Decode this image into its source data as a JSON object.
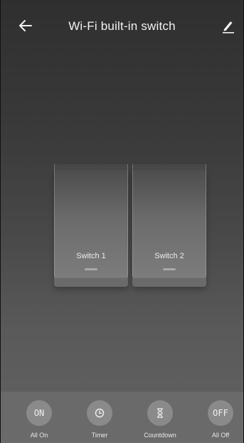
{
  "header": {
    "title": "Wi-Fi built-in switch",
    "back_icon": "arrow-left-icon",
    "edit_icon": "pencil-icon"
  },
  "switches": [
    {
      "label": "Switch 1"
    },
    {
      "label": "Switch 2"
    }
  ],
  "actions": [
    {
      "glyph": "ON",
      "label": "All On",
      "icon": "on-text-icon"
    },
    {
      "glyph": "",
      "label": "Timer",
      "icon": "clock-icon"
    },
    {
      "glyph": "",
      "label": "Countdown",
      "icon": "hourglass-icon"
    },
    {
      "glyph": "OFF",
      "label": "All Off",
      "icon": "off-text-icon"
    }
  ],
  "colors": {
    "background_top": "#2f2f2f",
    "background_bottom": "#626262",
    "text": "#f2f2f2",
    "action_circle": "#8a8a8a"
  }
}
